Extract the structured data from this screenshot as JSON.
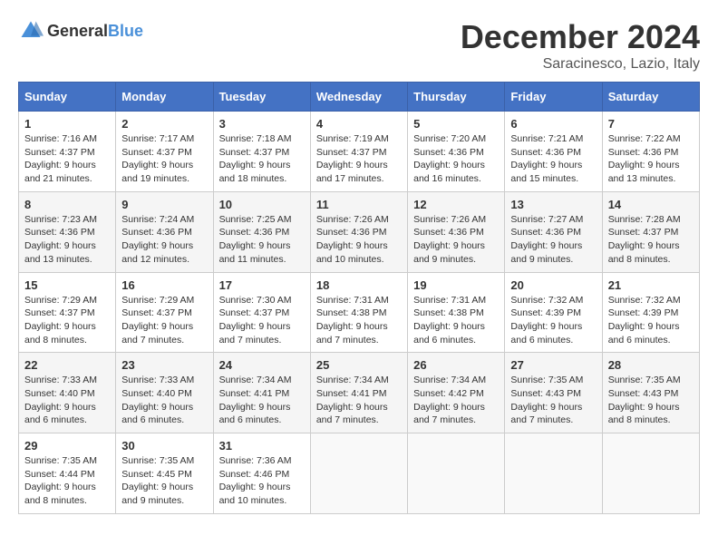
{
  "header": {
    "logo_general": "General",
    "logo_blue": "Blue",
    "title": "December 2024",
    "location": "Saracinesco, Lazio, Italy"
  },
  "calendar": {
    "days_of_week": [
      "Sunday",
      "Monday",
      "Tuesday",
      "Wednesday",
      "Thursday",
      "Friday",
      "Saturday"
    ],
    "weeks": [
      [
        null,
        null,
        null,
        null,
        null,
        null,
        null
      ]
    ],
    "cells": [
      {
        "day": null,
        "info": ""
      },
      {
        "day": null,
        "info": ""
      },
      {
        "day": null,
        "info": ""
      },
      {
        "day": null,
        "info": ""
      },
      {
        "day": null,
        "info": ""
      },
      {
        "day": null,
        "info": ""
      },
      {
        "day": null,
        "info": ""
      },
      {
        "day": "1",
        "sunrise": "7:16 AM",
        "sunset": "4:37 PM",
        "daylight": "9 hours and 21 minutes."
      },
      {
        "day": "2",
        "sunrise": "7:17 AM",
        "sunset": "4:37 PM",
        "daylight": "9 hours and 19 minutes."
      },
      {
        "day": "3",
        "sunrise": "7:18 AM",
        "sunset": "4:37 PM",
        "daylight": "9 hours and 18 minutes."
      },
      {
        "day": "4",
        "sunrise": "7:19 AM",
        "sunset": "4:37 PM",
        "daylight": "9 hours and 17 minutes."
      },
      {
        "day": "5",
        "sunrise": "7:20 AM",
        "sunset": "4:36 PM",
        "daylight": "9 hours and 16 minutes."
      },
      {
        "day": "6",
        "sunrise": "7:21 AM",
        "sunset": "4:36 PM",
        "daylight": "9 hours and 15 minutes."
      },
      {
        "day": "7",
        "sunrise": "7:22 AM",
        "sunset": "4:36 PM",
        "daylight": "9 hours and 13 minutes."
      },
      {
        "day": "8",
        "sunrise": "7:23 AM",
        "sunset": "4:36 PM",
        "daylight": "9 hours and 13 minutes."
      },
      {
        "day": "9",
        "sunrise": "7:24 AM",
        "sunset": "4:36 PM",
        "daylight": "9 hours and 12 minutes."
      },
      {
        "day": "10",
        "sunrise": "7:25 AM",
        "sunset": "4:36 PM",
        "daylight": "9 hours and 11 minutes."
      },
      {
        "day": "11",
        "sunrise": "7:26 AM",
        "sunset": "4:36 PM",
        "daylight": "9 hours and 10 minutes."
      },
      {
        "day": "12",
        "sunrise": "7:26 AM",
        "sunset": "4:36 PM",
        "daylight": "9 hours and 9 minutes."
      },
      {
        "day": "13",
        "sunrise": "7:27 AM",
        "sunset": "4:36 PM",
        "daylight": "9 hours and 9 minutes."
      },
      {
        "day": "14",
        "sunrise": "7:28 AM",
        "sunset": "4:37 PM",
        "daylight": "9 hours and 8 minutes."
      },
      {
        "day": "15",
        "sunrise": "7:29 AM",
        "sunset": "4:37 PM",
        "daylight": "9 hours and 8 minutes."
      },
      {
        "day": "16",
        "sunrise": "7:29 AM",
        "sunset": "4:37 PM",
        "daylight": "9 hours and 7 minutes."
      },
      {
        "day": "17",
        "sunrise": "7:30 AM",
        "sunset": "4:37 PM",
        "daylight": "9 hours and 7 minutes."
      },
      {
        "day": "18",
        "sunrise": "7:31 AM",
        "sunset": "4:38 PM",
        "daylight": "9 hours and 7 minutes."
      },
      {
        "day": "19",
        "sunrise": "7:31 AM",
        "sunset": "4:38 PM",
        "daylight": "9 hours and 6 minutes."
      },
      {
        "day": "20",
        "sunrise": "7:32 AM",
        "sunset": "4:39 PM",
        "daylight": "9 hours and 6 minutes."
      },
      {
        "day": "21",
        "sunrise": "7:32 AM",
        "sunset": "4:39 PM",
        "daylight": "9 hours and 6 minutes."
      },
      {
        "day": "22",
        "sunrise": "7:33 AM",
        "sunset": "4:40 PM",
        "daylight": "9 hours and 6 minutes."
      },
      {
        "day": "23",
        "sunrise": "7:33 AM",
        "sunset": "4:40 PM",
        "daylight": "9 hours and 6 minutes."
      },
      {
        "day": "24",
        "sunrise": "7:34 AM",
        "sunset": "4:41 PM",
        "daylight": "9 hours and 6 minutes."
      },
      {
        "day": "25",
        "sunrise": "7:34 AM",
        "sunset": "4:41 PM",
        "daylight": "9 hours and 7 minutes."
      },
      {
        "day": "26",
        "sunrise": "7:34 AM",
        "sunset": "4:42 PM",
        "daylight": "9 hours and 7 minutes."
      },
      {
        "day": "27",
        "sunrise": "7:35 AM",
        "sunset": "4:43 PM",
        "daylight": "9 hours and 7 minutes."
      },
      {
        "day": "28",
        "sunrise": "7:35 AM",
        "sunset": "4:43 PM",
        "daylight": "9 hours and 8 minutes."
      },
      {
        "day": "29",
        "sunrise": "7:35 AM",
        "sunset": "4:44 PM",
        "daylight": "9 hours and 8 minutes."
      },
      {
        "day": "30",
        "sunrise": "7:35 AM",
        "sunset": "4:45 PM",
        "daylight": "9 hours and 9 minutes."
      },
      {
        "day": "31",
        "sunrise": "7:36 AM",
        "sunset": "4:46 PM",
        "daylight": "9 hours and 10 minutes."
      },
      null,
      null,
      null,
      null
    ]
  }
}
